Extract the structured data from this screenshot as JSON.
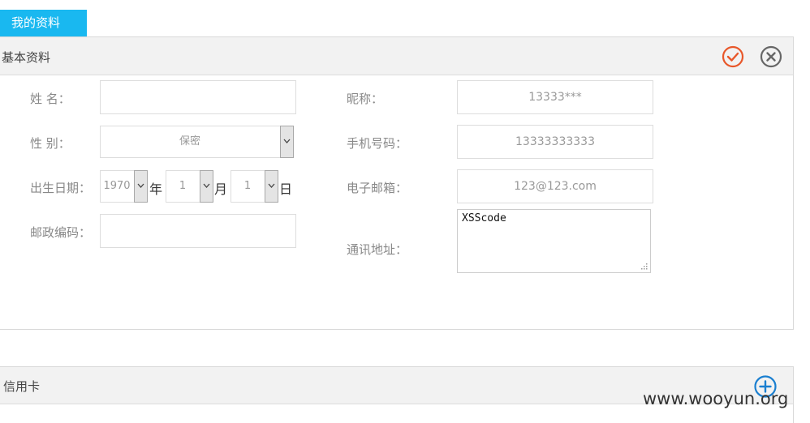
{
  "tab": {
    "label": "我的资料",
    "color": "#19b8f0"
  },
  "basic": {
    "title": "基本资料",
    "confirm_icon": "check-circle-icon",
    "cancel_icon": "x-circle-icon",
    "confirm_color": "#e8572a",
    "cancel_color": "#666666"
  },
  "form": {
    "name": {
      "label": "姓 名：",
      "value": ""
    },
    "gender": {
      "label": "性 别：",
      "value": "保密"
    },
    "birth": {
      "label": "出生日期：",
      "year": "1970",
      "year_unit": "年",
      "month": "1",
      "month_unit": "月",
      "day": "1",
      "day_unit": "日"
    },
    "postcode": {
      "label": "邮政编码：",
      "value": ""
    },
    "nickname": {
      "label": "昵称：",
      "value": "13333***"
    },
    "phone": {
      "label": "手机号码：",
      "value": "13333333333"
    },
    "email": {
      "label": "电子邮箱：",
      "value": "123@123.com"
    },
    "address": {
      "label": "通讯地址：",
      "value": "XSScode"
    }
  },
  "credit": {
    "title": "信用卡",
    "add_icon": "plus-circle-icon",
    "add_color": "#1a7fd0"
  },
  "watermark": "www.wooyun.org"
}
